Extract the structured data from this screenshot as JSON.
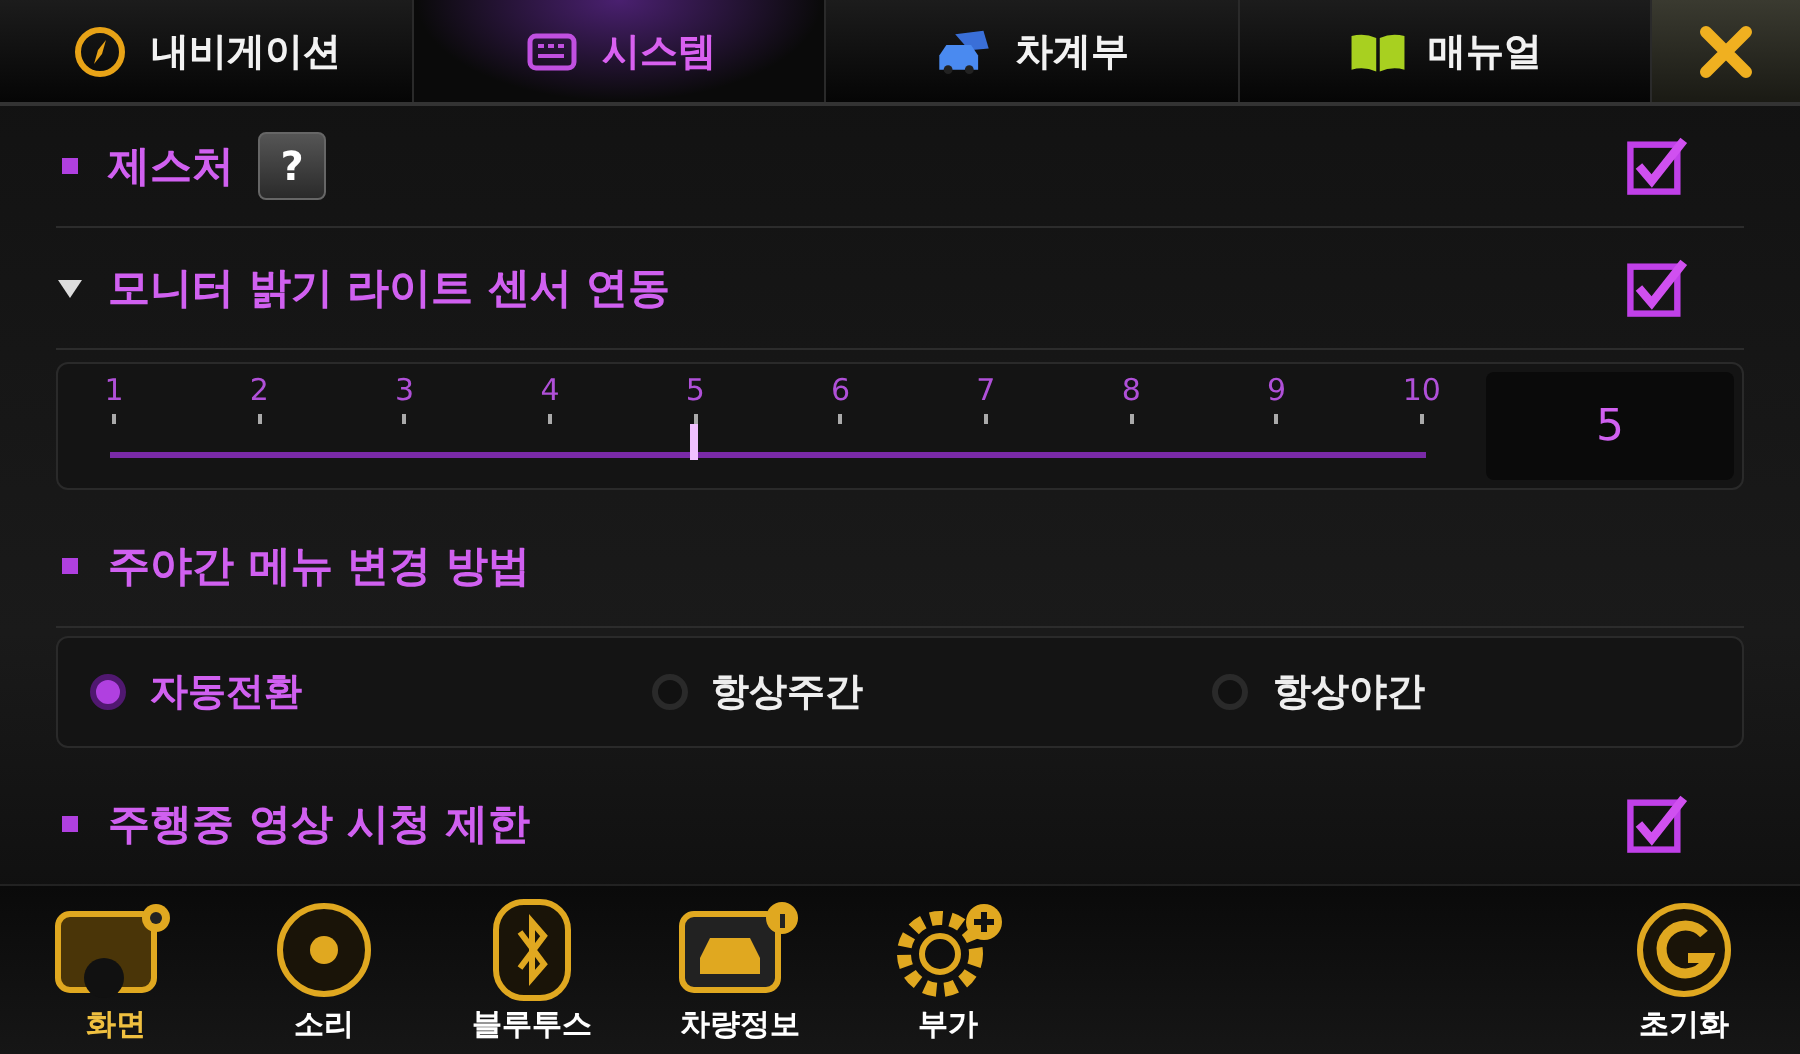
{
  "tabs": [
    {
      "label": "내비게이션",
      "selected": false
    },
    {
      "label": "시스템",
      "selected": true
    },
    {
      "label": "차계부",
      "selected": false
    },
    {
      "label": "매뉴얼",
      "selected": false
    }
  ],
  "settings": [
    {
      "kind": "check",
      "label": "제스처",
      "help": "?",
      "expanded": false,
      "checked": true
    },
    {
      "kind": "check",
      "label": "모니터 밝기 라이트 센서 연동",
      "expanded": true,
      "checked": true,
      "slider": {
        "ticks": [
          "1",
          "2",
          "3",
          "4",
          "5",
          "6",
          "7",
          "8",
          "9",
          "10"
        ],
        "level": 0.444,
        "reading": "5"
      }
    },
    {
      "kind": "radio",
      "label": "주야간 메뉴 변경 방법",
      "expanded": false,
      "options": [
        {
          "label": "자동전환",
          "selected": true
        },
        {
          "label": "항상주간",
          "selected": false
        },
        {
          "label": "항상야간",
          "selected": false
        }
      ]
    },
    {
      "kind": "check",
      "label": "주행중 영상 시청 제한",
      "expanded": false,
      "checked": true
    }
  ],
  "dock": [
    {
      "label": "화면",
      "selected": true
    },
    {
      "label": "소리",
      "selected": false
    },
    {
      "label": "블루투스",
      "selected": false
    },
    {
      "label": "차량정보",
      "selected": false
    },
    {
      "label": "부가",
      "selected": false
    }
  ],
  "reset": {
    "label": "초기화"
  }
}
